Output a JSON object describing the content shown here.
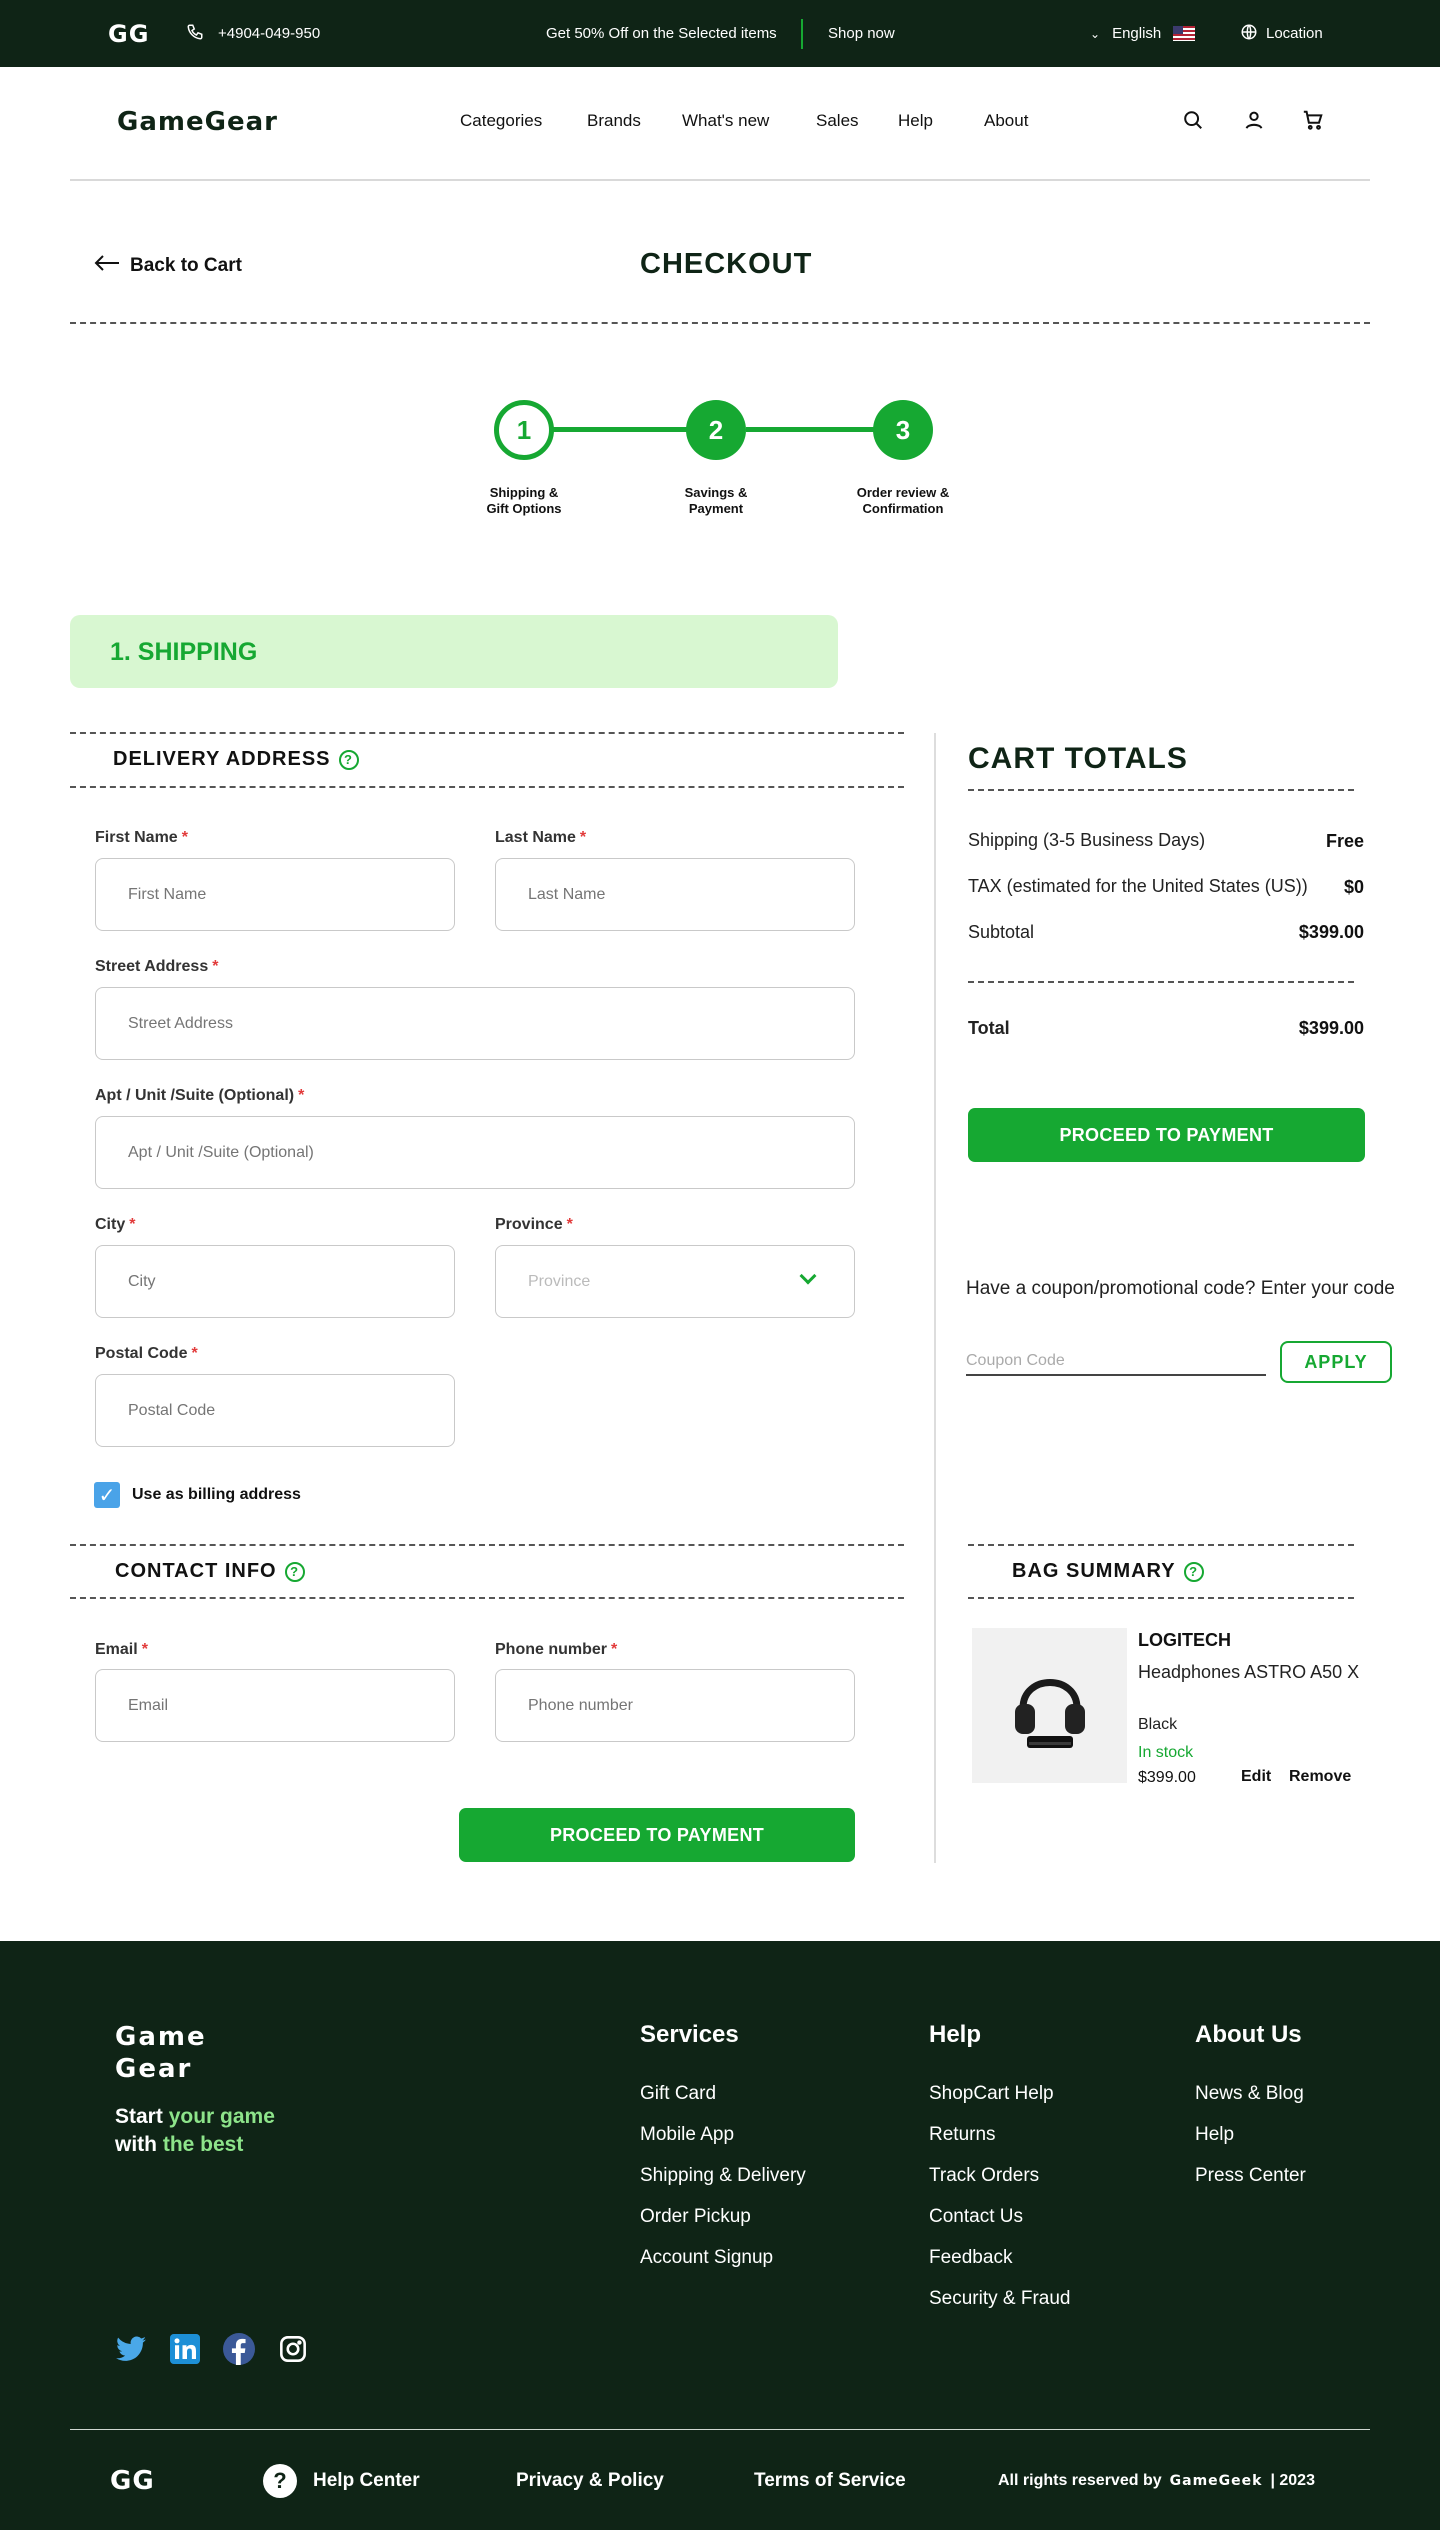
{
  "topbar": {
    "logo": "GG",
    "phone": "+4904-049-950",
    "promo": "Get 50% Off on the Selected items",
    "shop_now": "Shop now",
    "language": "English",
    "location": "Location"
  },
  "header": {
    "brand": "GameGear",
    "nav": [
      "Categories",
      "Brands",
      "What's new",
      "Sales",
      "Help",
      "About"
    ]
  },
  "checkout": {
    "back": "Back to Cart",
    "title": "CHECKOUT",
    "steps": [
      {
        "num": "1",
        "label": "Shipping &\nGift Options"
      },
      {
        "num": "2",
        "label": "Savings &\nPayment"
      },
      {
        "num": "3",
        "label": "Order review &\nConfirmation"
      }
    ],
    "section_banner": "1. SHIPPING"
  },
  "delivery": {
    "heading": "DELIVERY ADDRESS",
    "first_name": {
      "label": "First Name",
      "placeholder": "First Name"
    },
    "last_name": {
      "label": "Last Name",
      "placeholder": "Last Name"
    },
    "street": {
      "label": "Street Address",
      "placeholder": "Street Address"
    },
    "apt": {
      "label": "Apt / Unit /Suite (Optional)",
      "placeholder": "Apt / Unit /Suite (Optional)"
    },
    "city": {
      "label": "City",
      "placeholder": "City"
    },
    "province": {
      "label": "Province",
      "placeholder": "Province"
    },
    "postal": {
      "label": "Postal Code",
      "placeholder": "Postal Code"
    },
    "billing_checkbox": "Use as billing address"
  },
  "contact": {
    "heading": "CONTACT INFO",
    "email": {
      "label": "Email",
      "placeholder": "Email"
    },
    "phone": {
      "label": "Phone number",
      "placeholder": "Phone number"
    },
    "proceed": "PROCEED TO PAYMENT"
  },
  "cart_totals": {
    "title": "CART TOTALS",
    "shipping_label": "Shipping (3-5 Business Days)",
    "shipping_value": "Free",
    "tax_label": "TAX (estimated for the United States (US))",
    "tax_value": "$0",
    "subtotal_label": "Subtotal",
    "subtotal_value": "$399.00",
    "total_label": "Total",
    "total_value": "$399.00",
    "proceed": "PROCEED TO PAYMENT",
    "coupon_prompt": "Have a coupon/promotional code? Enter your code",
    "coupon_placeholder": "Coupon Code",
    "apply": "APPLY"
  },
  "bag_summary": {
    "heading": "BAG SUMMARY",
    "brand": "LOGITECH",
    "name": "Headphones ASTRO A50 X",
    "color": "Black",
    "stock": "In stock",
    "price": "$399.00",
    "edit": "Edit",
    "remove": "Remove"
  },
  "footer": {
    "logo_line1": "Game",
    "logo_line2": "Gear",
    "tagline": {
      "w1": "Start ",
      "g1": "your game",
      "w2": "with ",
      "g2": "the best"
    },
    "services": {
      "title": "Services",
      "items": [
        "Gift Card",
        "Mobile App",
        "Shipping & Delivery",
        "Order Pickup",
        "Account Signup"
      ]
    },
    "help": {
      "title": "Help",
      "items": [
        "ShopCart Help",
        "Returns",
        "Track Orders",
        "Contact Us",
        "Feedback",
        "Security & Fraud"
      ]
    },
    "about": {
      "title": "About Us",
      "items": [
        "News & Blog",
        "Help",
        "Press Center"
      ]
    },
    "bottom_logo": "GG",
    "help_center": "Help Center",
    "privacy": "Privacy & Policy",
    "terms": "Terms of Service",
    "rights": "All rights reserved by",
    "rights_brand": "GameGeek",
    "year": "| 2023"
  },
  "colors": {
    "dark_green": "#0f2416",
    "accent_green": "#16a832",
    "light_green": "#d8f7d1"
  }
}
